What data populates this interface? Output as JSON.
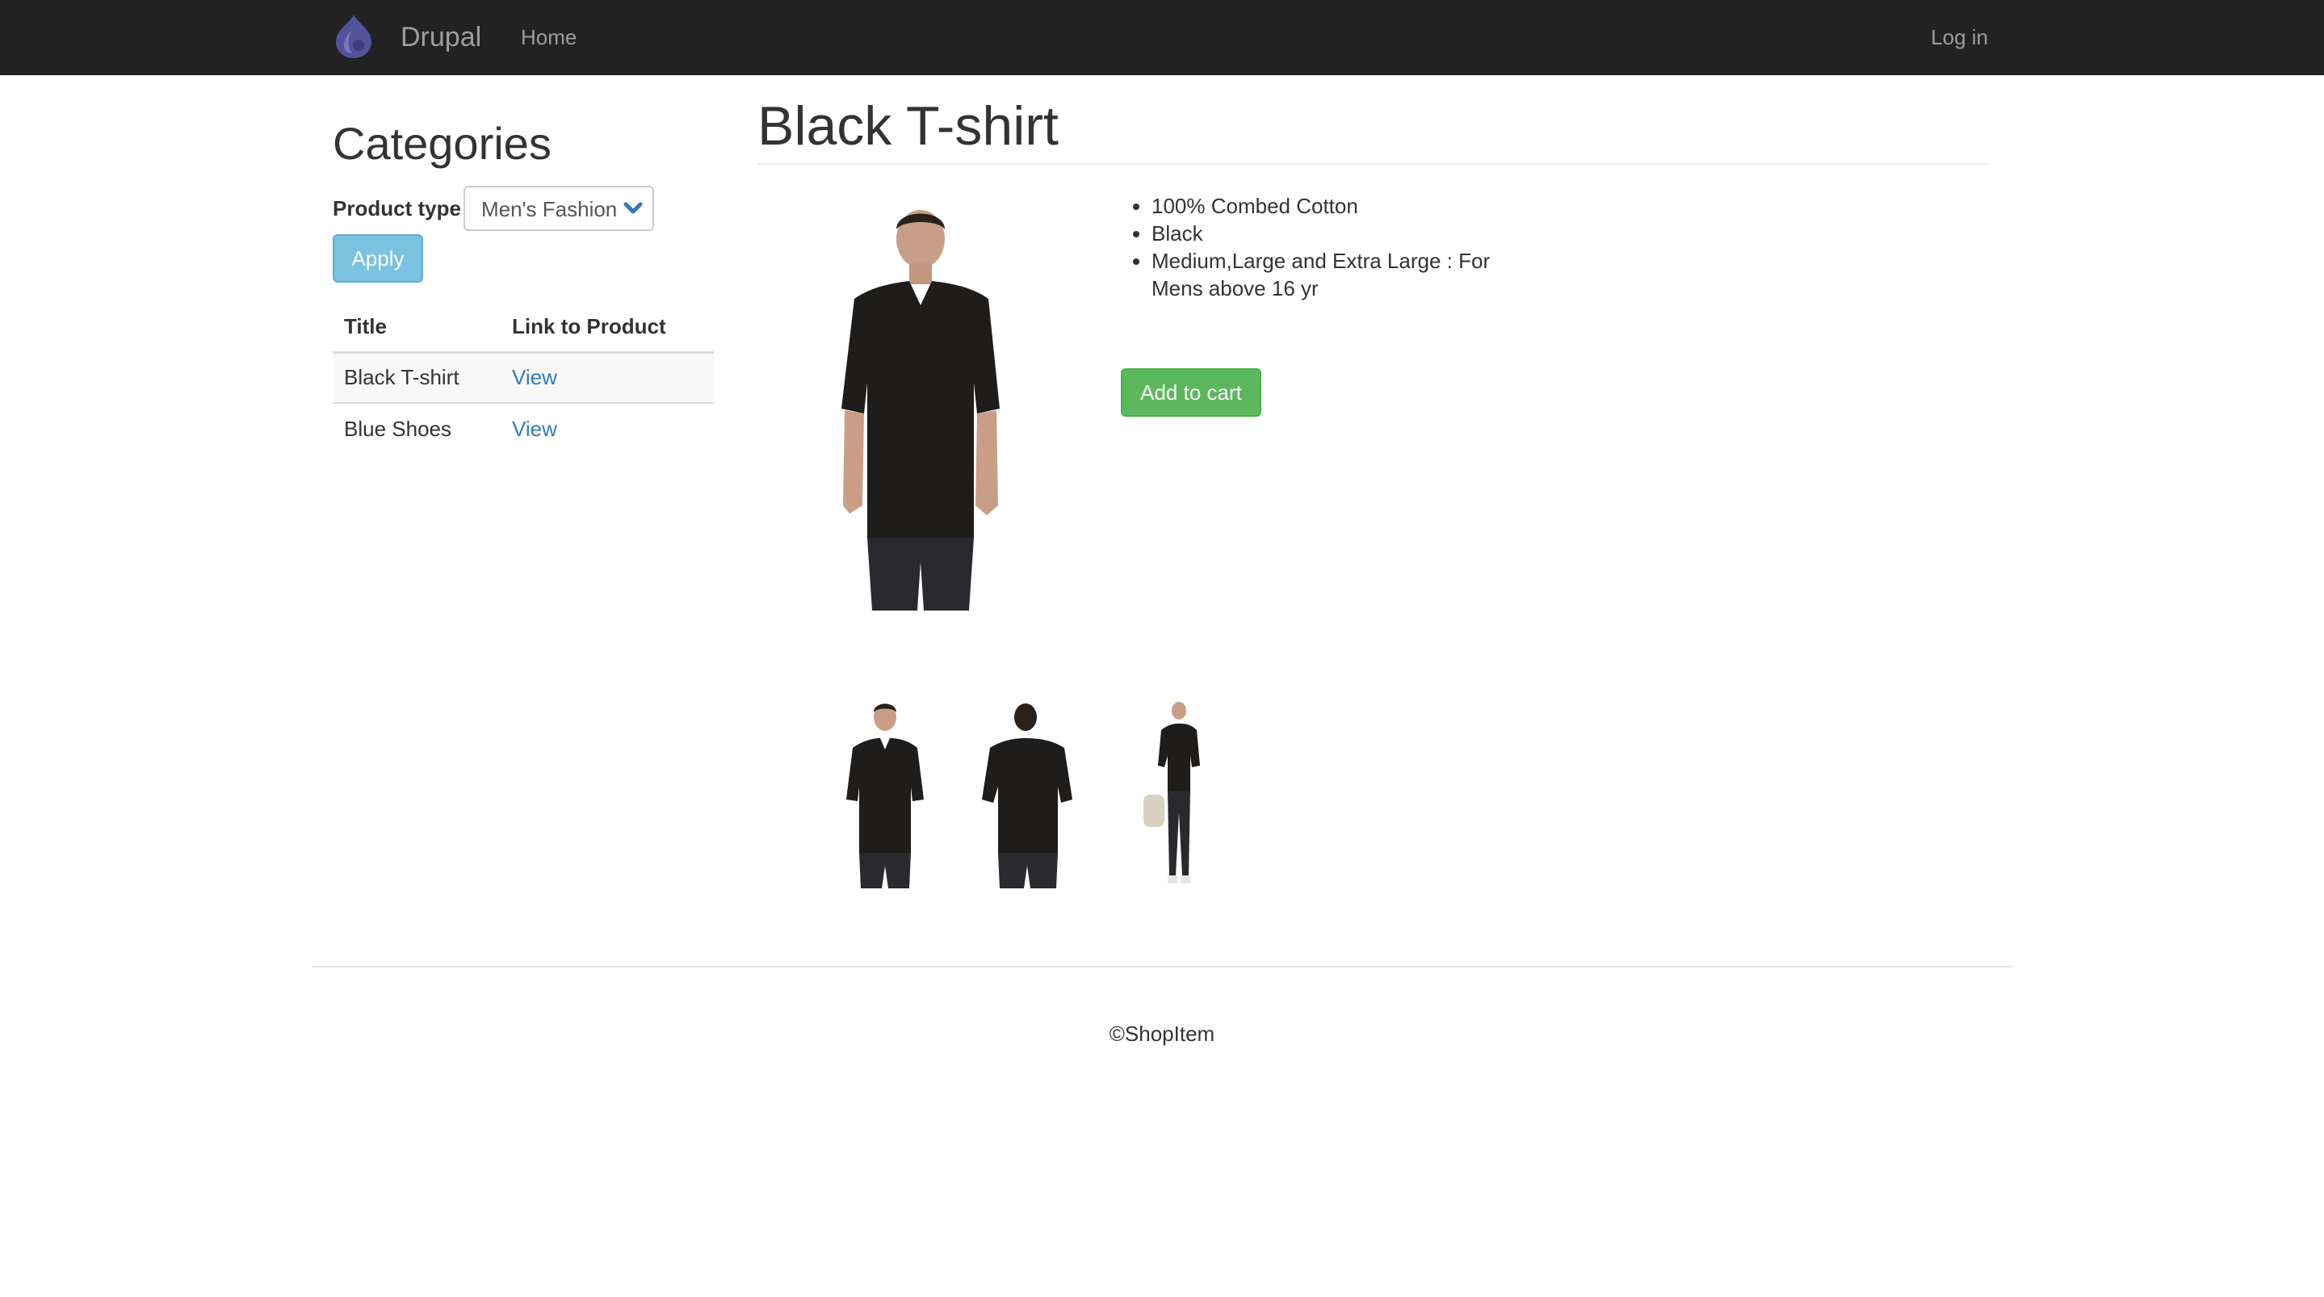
{
  "navbar": {
    "brand": "Drupal",
    "home": "Home",
    "login": "Log in"
  },
  "sidebar": {
    "heading": "Categories",
    "filter_label": "Product type",
    "filter_value": "Men's Fashion",
    "apply_label": "Apply",
    "table": {
      "headers": [
        "Title",
        "Link to Product"
      ],
      "rows": [
        {
          "title": "Black T-shirt",
          "link": "View"
        },
        {
          "title": "Blue Shoes",
          "link": "View"
        }
      ]
    }
  },
  "product": {
    "title": "Black T-shirt",
    "specs": [
      "100% Combed Cotton",
      "Black",
      "Medium,Large and Extra Large : For Mens above 16 yr"
    ],
    "cart_label": "Add to cart"
  },
  "footer": {
    "text": "©ShopItem"
  },
  "colors": {
    "navbar_bg": "#222222",
    "nav_text": "#9d9d9d",
    "link": "#337ab7",
    "apply_bg": "#7bc2e0",
    "cart_bg": "#5cb85c",
    "drupal_logo": "#53539b"
  },
  "icons": {
    "brand_logo": "drupal-drop-icon",
    "select_arrow": "chevron-down-icon"
  }
}
